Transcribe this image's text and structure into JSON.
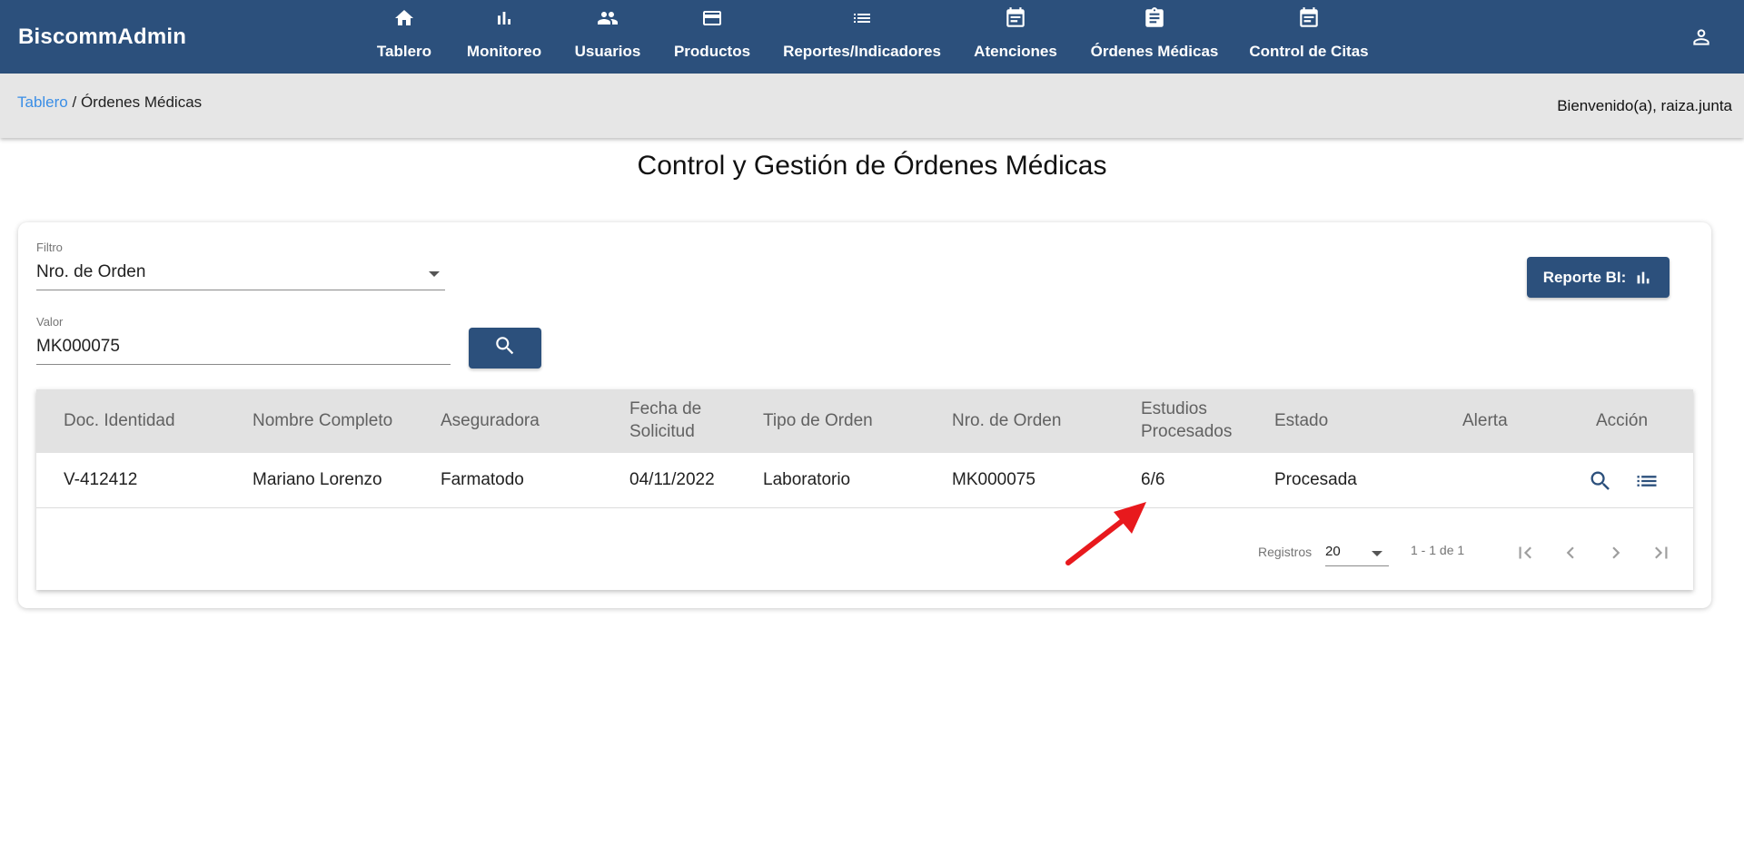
{
  "app": {
    "title": "BiscommAdmin"
  },
  "nav": {
    "items": [
      {
        "label": "Tablero",
        "icon": "home-icon"
      },
      {
        "label": "Monitoreo",
        "icon": "bar-chart-icon"
      },
      {
        "label": "Usuarios",
        "icon": "people-icon"
      },
      {
        "label": "Productos",
        "icon": "credit-card-icon"
      },
      {
        "label": "Reportes/Indicadores",
        "icon": "list-icon"
      },
      {
        "label": "Atenciones",
        "icon": "event-note-icon"
      },
      {
        "label": "Órdenes Médicas",
        "icon": "clipboard-icon"
      },
      {
        "label": "Control de Citas",
        "icon": "event-note-icon"
      }
    ]
  },
  "breadcrumb": {
    "root": "Tablero",
    "separator": " / ",
    "current": "Órdenes Médicas"
  },
  "header": {
    "welcome": "Bienvenido(a), raiza.junta"
  },
  "page": {
    "title": "Control y Gestión de Órdenes Médicas"
  },
  "filter": {
    "label": "Filtro",
    "value": "Nro. de Orden"
  },
  "search": {
    "label": "Valor",
    "value": "MK000075"
  },
  "report_button": {
    "label": "Reporte BI:"
  },
  "table": {
    "headers": {
      "doc": "Doc. Identidad",
      "name": "Nombre Completo",
      "insurer": "Aseguradora",
      "date_line1": "Fecha de",
      "date_line2": "Solicitud",
      "type": "Tipo de Orden",
      "order": "Nro. de Orden",
      "studies_line1": "Estudios",
      "studies_line2": "Procesados",
      "status": "Estado",
      "alert": "Alerta",
      "action": "Acción"
    },
    "rows": [
      {
        "doc": "V-412412",
        "name": "Mariano Lorenzo",
        "insurer": "Farmatodo",
        "date": "04/11/2022",
        "type": "Laboratorio",
        "order": "MK000075",
        "studies": "6/6",
        "status": "Procesada",
        "alert": ""
      }
    ]
  },
  "paginator": {
    "label": "Registros",
    "page_size": "20",
    "range": "1 - 1 de 1"
  },
  "colors": {
    "primary": "#2c507c",
    "link": "#3a8ee6",
    "annotation_arrow": "#e8191d"
  }
}
